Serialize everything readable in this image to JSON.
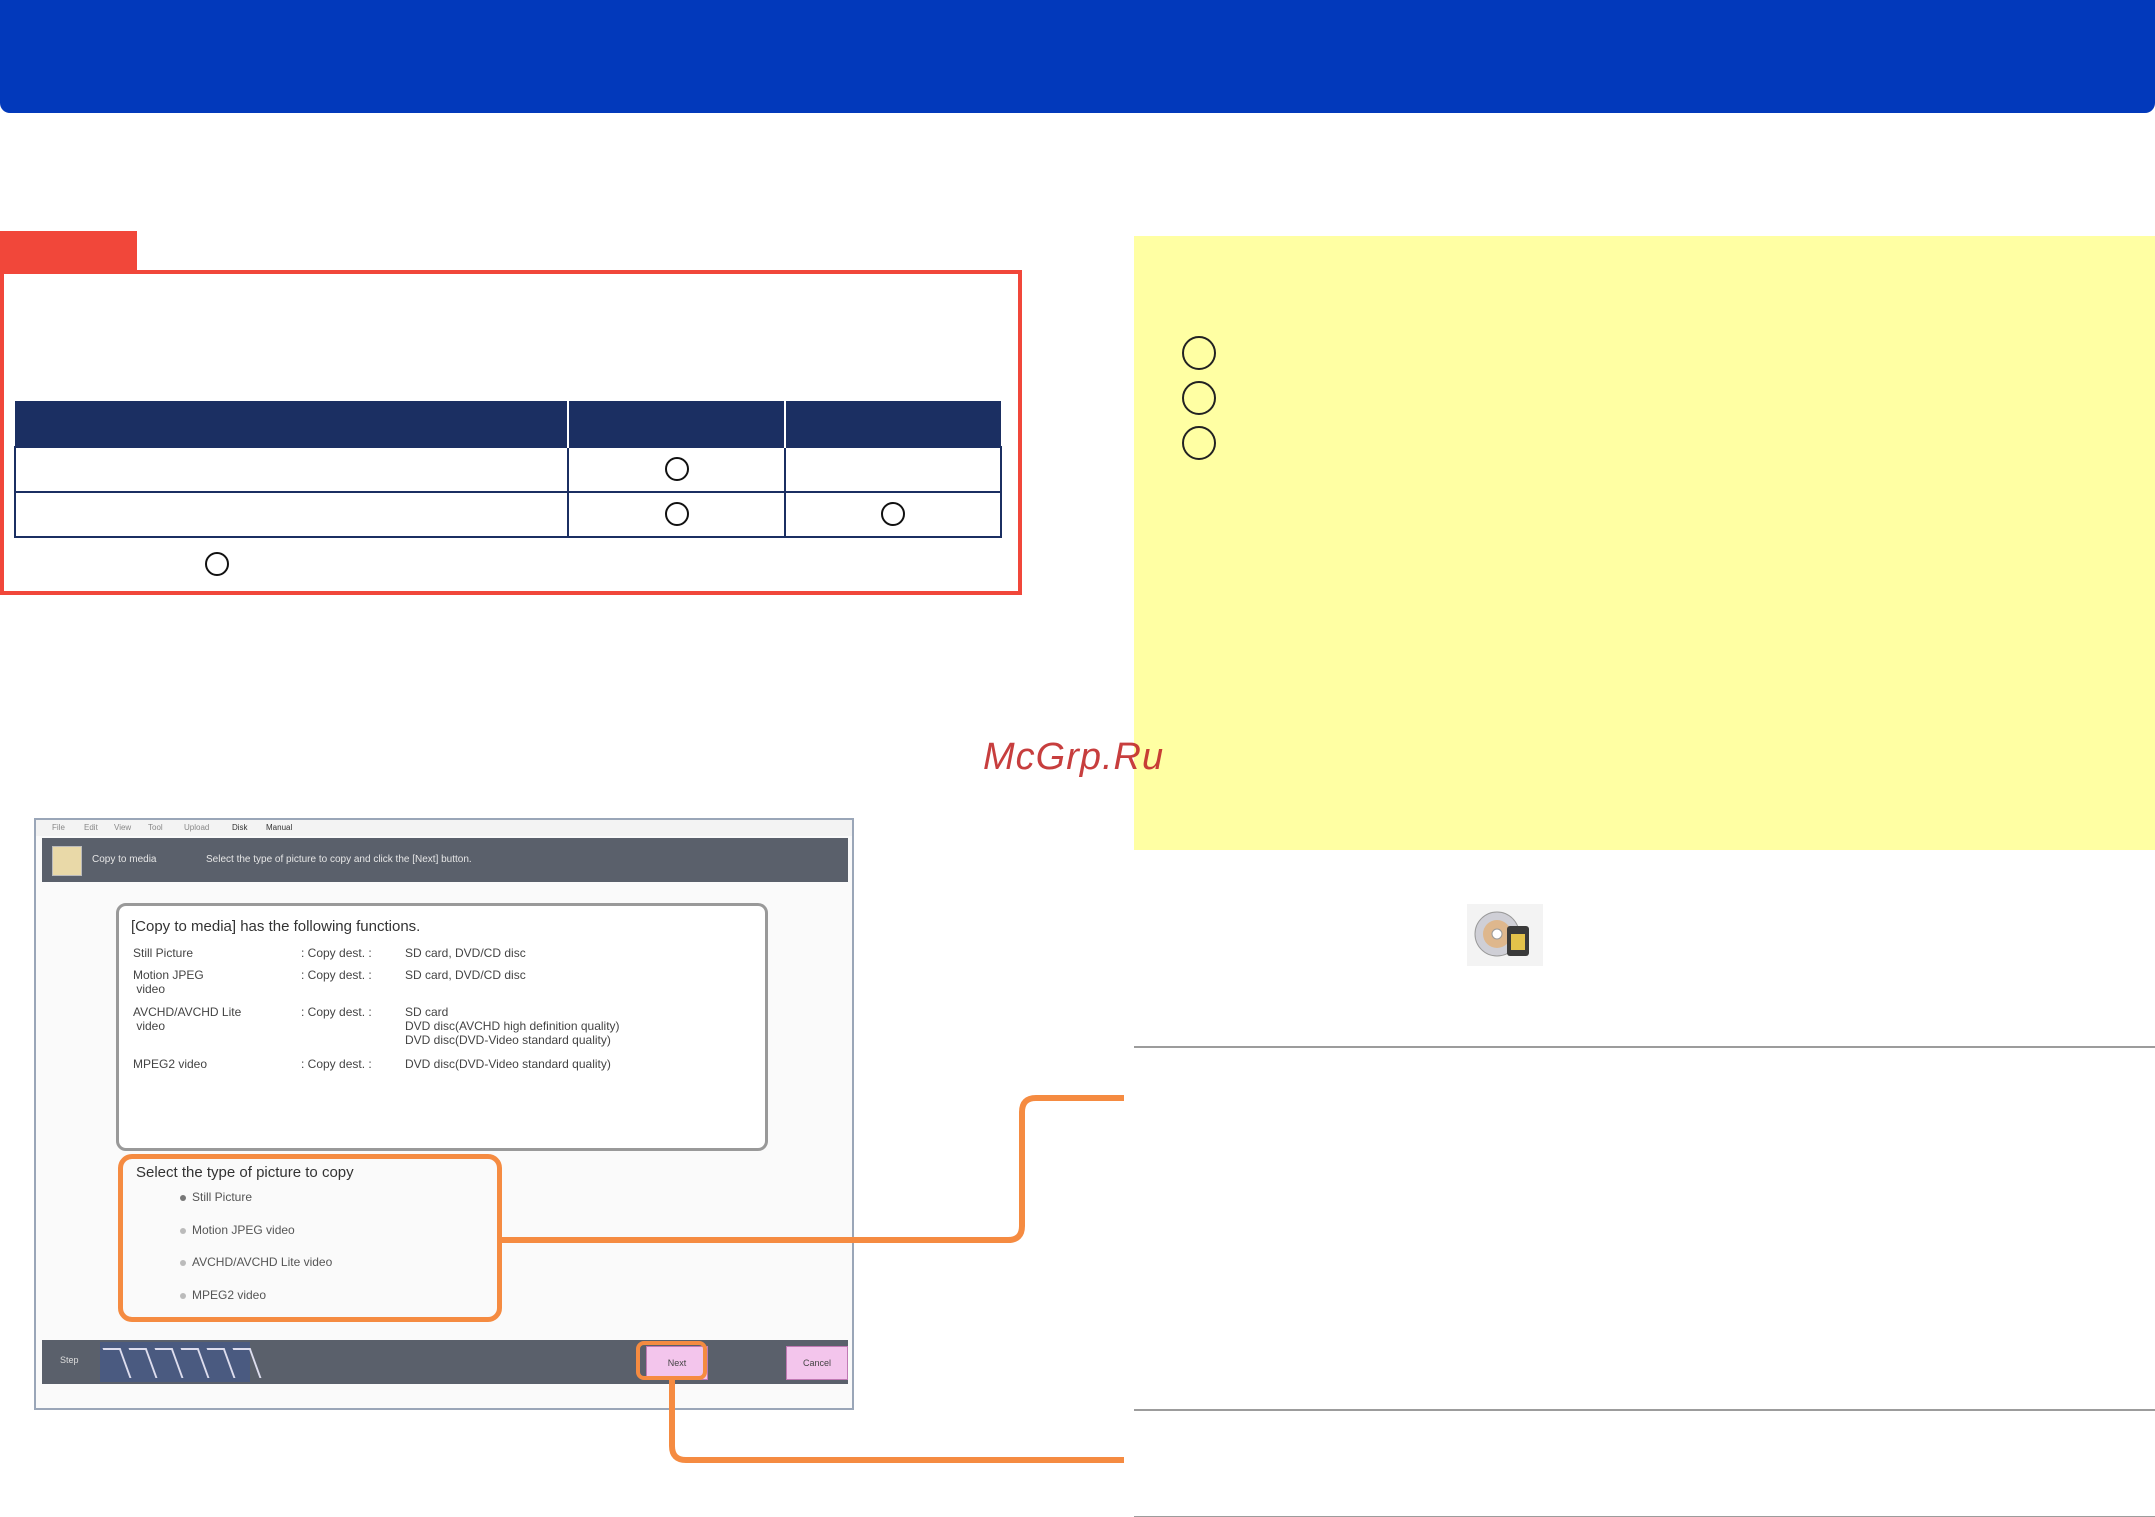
{
  "header": {
    "title": ""
  },
  "compat_table": {
    "headers": [
      "",
      "",
      ""
    ],
    "rows": [
      {
        "label": "",
        "col1": "circle",
        "col2": ""
      },
      {
        "label": "",
        "col1": "circle",
        "col2": "circle"
      }
    ]
  },
  "note": {
    "numbered_items": 3
  },
  "watermark": "McGrp.Ru",
  "screenshot": {
    "menu": [
      "File",
      "Edit",
      "View",
      "Tool",
      "Upload",
      "Disk",
      "Manual"
    ],
    "title": "Copy to media",
    "instruction": "Select the type of picture to copy and click the [Next] button.",
    "functions_heading": "[Copy to media] has the following functions.",
    "functions": [
      {
        "type": "Still Picture",
        "dest_label": ": Copy dest. :",
        "dest": "SD card, DVD/CD disc"
      },
      {
        "type": "Motion JPEG\n video",
        "dest_label": ": Copy dest. :",
        "dest": "SD card, DVD/CD disc"
      },
      {
        "type": "AVCHD/AVCHD Lite\n video",
        "dest_label": ": Copy dest. :",
        "dest": "SD card\nDVD disc(AVCHD high definition quality)\nDVD disc(DVD-Video standard quality)"
      },
      {
        "type": "MPEG2 video",
        "dest_label": ": Copy dest. :",
        "dest": "DVD disc(DVD-Video standard quality)"
      }
    ],
    "select_label": "Select the type of picture to copy",
    "options": [
      "Still Picture",
      "Motion JPEG video",
      "AVCHD/AVCHD Lite video",
      "MPEG2 video"
    ],
    "selected_option": "Still Picture",
    "footer": {
      "step_label": "Step",
      "next": "Next",
      "cancel": "Cancel"
    }
  },
  "colors": {
    "header": "#0239bb",
    "accent_red": "#f1473a",
    "table_header": "#1b2f62",
    "note_bg": "#ffffa3",
    "highlight": "#f58b41"
  },
  "icons": [
    "circle-mark",
    "copy-to-media-icon"
  ]
}
